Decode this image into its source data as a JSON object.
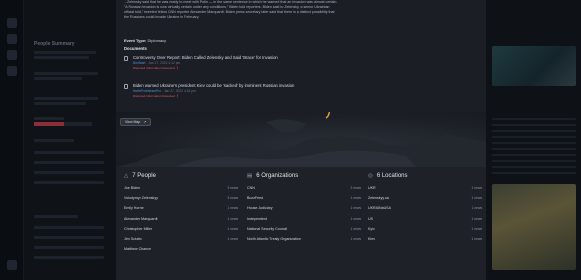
{
  "background": {
    "panel_title": "People Summary"
  },
  "modal": {
    "description": "...Zelensky said that he was ready to meet with Putin — in the same sentence in which he warned that an invasion was almost certain. \"A Russian invasion is now virtually certain under any conditions,\" Biden told reporters. Biden said to Zelensky, a senior Ukrainian official told,\" tweeted fellow CNN reporter Alexander Marquardt. Biden press secretary later said that there is a distinct possibility that the Russians could invade Ukraine in February.",
    "event_type_label": "Event Type:",
    "event_type_value": "Diplomacy",
    "documents_heading": "Documents",
    "documents": [
      {
        "title": "Controversy Over Report: Biden Called Zelensky and Said 'Brace' for Invasion",
        "source": "Breitbart",
        "date": "Jan 27, 2022 4:12 pm",
        "tag": "Disputed Information Detected"
      },
      {
        "title": "Biden warned Ukraine's president Kiev could be 'sacked' by imminent Russian invasion",
        "source": "NorthPoleNewsPro",
        "date": "Jan 27, 2022 4:24 pm",
        "tag": "Disputed Information Detected"
      }
    ],
    "view_map_label": "View Map",
    "view_map_icon": "expand-icon",
    "people": {
      "heading": "7 People",
      "icon": "user-icon",
      "items": [
        {
          "name": "Joe Biden",
          "count": "3 news"
        },
        {
          "name": "Volodymyr Zelenskyy",
          "count": "3 news"
        },
        {
          "name": "Emily Horne",
          "count": "1 news"
        },
        {
          "name": "Alexander Marquardt",
          "count": "1 news"
        },
        {
          "name": "Christopher Miller",
          "count": "1 news"
        },
        {
          "name": "Jim Sciutto",
          "count": "1 news"
        },
        {
          "name": "Matthew Chance",
          "count": "1 news"
        }
      ]
    },
    "organizations": {
      "heading": "6 Organizations",
      "icon": "folder-icon",
      "items": [
        {
          "name": "CNN",
          "count": "2 news"
        },
        {
          "name": "BuzzFeed",
          "count": "1 news"
        },
        {
          "name": "House Judiciary",
          "count": "1 news"
        },
        {
          "name": "Independent",
          "count": "1 news"
        },
        {
          "name": "National Security Council",
          "count": "1 news"
        },
        {
          "name": "North Atlantic Treaty Organization",
          "count": "1 news"
        }
      ]
    },
    "locations": {
      "heading": "6 Locations",
      "icon": "location-icon",
      "items": [
        {
          "name": "UKR",
          "count": "1 news"
        },
        {
          "name": "Zelenskyy.ua",
          "count": "1 news"
        },
        {
          "name": "UKRAINaUSA",
          "count": "1 news"
        },
        {
          "name": "US",
          "count": "1 news"
        },
        {
          "name": "Kyiv",
          "count": "1 news"
        },
        {
          "name": "Kiev",
          "count": "1 news"
        }
      ]
    }
  },
  "colors": {
    "modal_bg": "#1b1e24",
    "entities_bg": "#1e2228",
    "disputed_tag": "#e05a66",
    "source_link": "#4f8fd9",
    "map_marker": "#f0a23a"
  }
}
